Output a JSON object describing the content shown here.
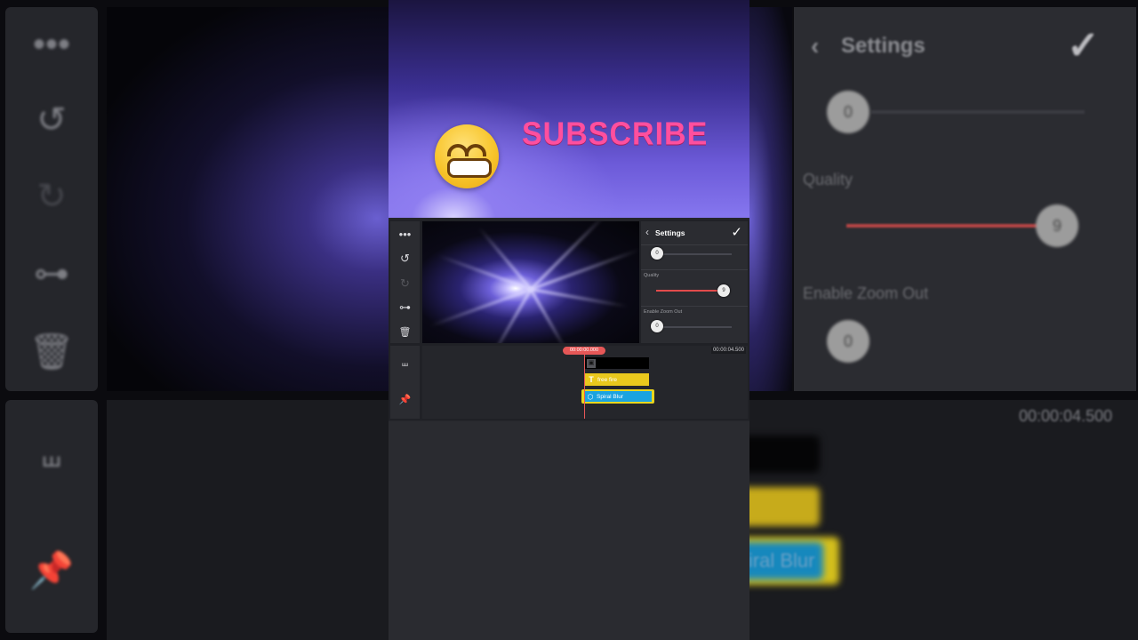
{
  "banner": {
    "text": "SUBSCRIBE",
    "emoji_name": "grinning-face-icon"
  },
  "toolbar": {
    "more": "•••",
    "undo": "↺",
    "redo": "↻",
    "keyframe": "⊶",
    "delete": "🗑",
    "split": "⧢",
    "pin": "📌"
  },
  "settings": {
    "back": "‹",
    "title": "Settings",
    "confirm": "✓",
    "slider1": {
      "label": "",
      "value": "0",
      "fraction": 0.0
    },
    "quality": {
      "label": "Quality",
      "value": "9",
      "fraction": 1.0
    },
    "zoom_out": {
      "label": "Enable Zoom Out",
      "value": "0",
      "fraction": 0.0
    }
  },
  "timeline": {
    "current_time": "00:00:00.000",
    "end_time": "00:00:04.500",
    "clips": {
      "image_clip_icon": "▣",
      "text_clip_icon": "T",
      "text_clip_label": "free fire",
      "fx_clip_icon": "⬡",
      "fx_clip_label": "Spiral Blur"
    }
  },
  "colors": {
    "accent_red": "#e65757",
    "text_clip": "#e9c81d",
    "fx_clip": "#1aa3e0",
    "subscribe_pink": "#ff4f9e"
  }
}
